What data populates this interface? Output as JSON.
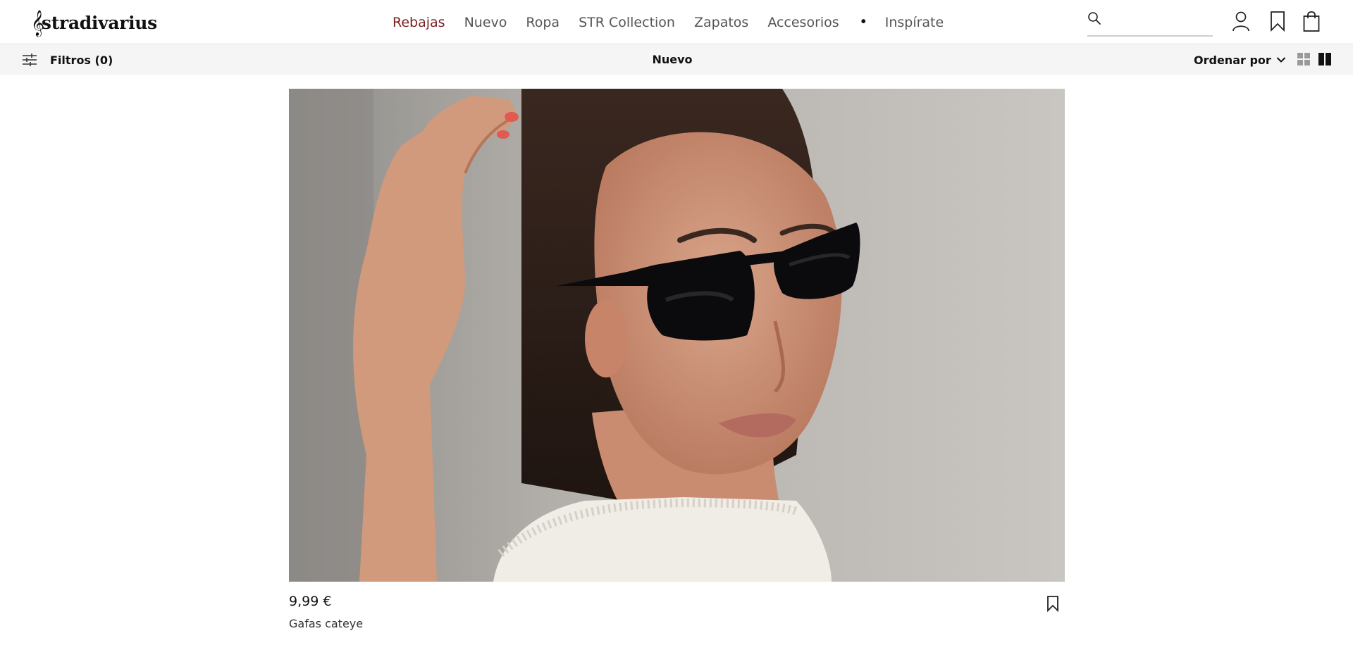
{
  "brand": {
    "logo_text": "stradivarius"
  },
  "nav": {
    "items": [
      {
        "label": "Rebajas",
        "active": true
      },
      {
        "label": "Nuevo"
      },
      {
        "label": "Ropa"
      },
      {
        "label": "STR Collection"
      },
      {
        "label": "Zapatos"
      },
      {
        "label": "Accesorios"
      }
    ],
    "dot": "•",
    "last": "Inspírate"
  },
  "search": {
    "value": "",
    "placeholder": "",
    "icon": "search-icon"
  },
  "header_icons": [
    "user-icon",
    "bookmark-icon",
    "shopping-bag-icon"
  ],
  "subbar": {
    "filters_label": "Filtros (0)",
    "title": "Nuevo",
    "sort_label": "Ordenar por",
    "view_options": [
      "grid-view-icon",
      "two-column-view-icon"
    ]
  },
  "product": {
    "price": "9,99 €",
    "name": "Gafas cateye",
    "save_icon": "bookmark-icon"
  },
  "colors": {
    "accent": "#7a1f22",
    "subbar_bg": "#f5f5f5",
    "text": "#111111"
  }
}
